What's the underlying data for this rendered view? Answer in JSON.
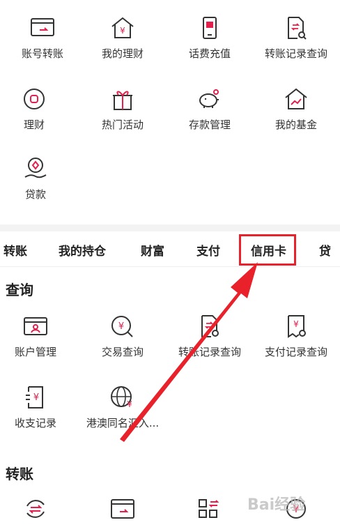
{
  "top_grid": [
    {
      "label": "账号转账",
      "icon": "card-transfer-icon"
    },
    {
      "label": "我的理财",
      "icon": "house-yuan-icon"
    },
    {
      "label": "话费充值",
      "icon": "phone-recharge-icon"
    },
    {
      "label": "转账记录查询",
      "icon": "transfer-record-icon"
    },
    {
      "label": "理财",
      "icon": "wealth-circle-icon"
    },
    {
      "label": "热门活动",
      "icon": "gift-icon"
    },
    {
      "label": "存款管理",
      "icon": "piggy-bank-icon"
    },
    {
      "label": "我的基金",
      "icon": "house-chart-icon"
    },
    {
      "label": "贷款",
      "icon": "loan-hand-icon"
    }
  ],
  "tabs": [
    "转账",
    "我的持仓",
    "财富",
    "支付",
    "信用卡",
    "贷"
  ],
  "highlighted_tab": "信用卡",
  "sections": {
    "query": {
      "title": "查询",
      "items": [
        {
          "label": "账户管理",
          "icon": "account-card-icon"
        },
        {
          "label": "交易查询",
          "icon": "yuan-search-icon"
        },
        {
          "label": "转账记录查询",
          "icon": "transfer-record-icon"
        },
        {
          "label": "支付记录查询",
          "icon": "payment-record-icon"
        },
        {
          "label": "收支记录",
          "icon": "income-record-icon"
        },
        {
          "label": "港澳同名汇入...",
          "icon": "globe-yuan-icon"
        }
      ]
    },
    "transfer": {
      "title": "转账",
      "items": [
        {
          "icon": "exchange-circle-icon"
        },
        {
          "icon": "card-icon"
        },
        {
          "icon": "qr-transfer-icon"
        },
        {
          "icon": "yuan-badge-icon"
        }
      ]
    }
  },
  "watermark": "Bai经验",
  "colors": {
    "accent": "#e2204b",
    "highlight": "#e8212b",
    "icon_stroke": "#333333"
  }
}
